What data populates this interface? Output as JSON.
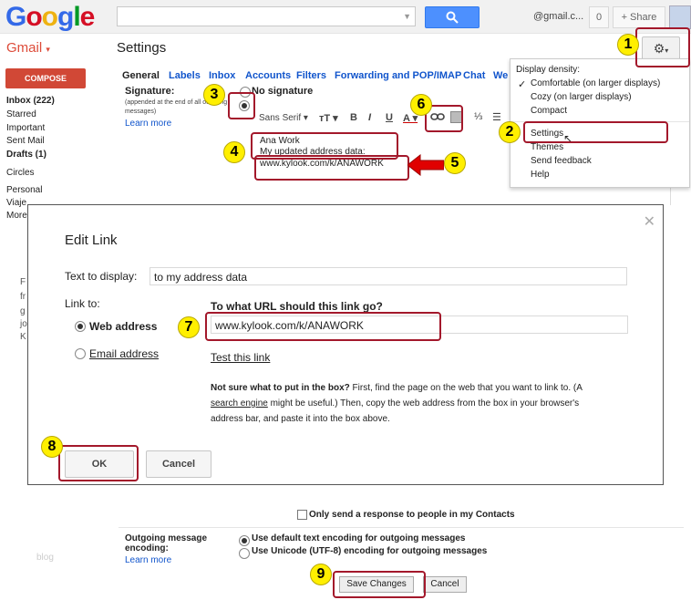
{
  "header": {
    "account": "@gmail.c...",
    "notifications": "0",
    "share": "+ Share",
    "app": "Gmail",
    "page_title": "Settings"
  },
  "sidebar": {
    "compose": "COMPOSE",
    "items": [
      {
        "label": "Inbox (222)",
        "bold": true
      },
      {
        "label": "Starred"
      },
      {
        "label": "Important"
      },
      {
        "label": "Sent Mail"
      },
      {
        "label": "Drafts (1)",
        "bold": true
      },
      {
        "label": "Circles"
      },
      {
        "label": "Personal"
      },
      {
        "label": "Viaje"
      },
      {
        "label": "More"
      }
    ],
    "faint": [
      "F",
      "fr",
      "g",
      "jo",
      "K"
    ],
    "blog": "blog"
  },
  "tabs": [
    "General",
    "Labels",
    "Inbox",
    "Accounts",
    "Filters",
    "Forwarding and POP/IMAP",
    "Chat",
    "We"
  ],
  "signature": {
    "label": "Signature:",
    "note": "(appended at the end of all outgoing messages)",
    "learn_more": "Learn more",
    "no_signature": "No signature",
    "font": "Sans Serif",
    "lines": [
      "Ana Work",
      "My updated address data:",
      "www.kylook.com/k/ANAWORK"
    ]
  },
  "menu": {
    "heading": "Display density:",
    "items": [
      "Comfortable (on larger displays)",
      "Cozy (on larger displays)",
      "Compact",
      "Settings",
      "Themes",
      "Send feedback",
      "Help"
    ]
  },
  "dialog": {
    "title": "Edit Link",
    "text_label": "Text to display:",
    "text_value": "to my address data",
    "link_to": "Link to:",
    "web_address": "Web address",
    "email_address": "Email address",
    "url_question": "To what URL should this link go?",
    "url_value": "www.kylook.com/k/ANAWORK",
    "test_link": "Test this link",
    "help_bold": "Not sure what to put in the box?",
    "help_1": " First, find the page on the web that you want to link to. (A",
    "help_link": "search engine",
    "help_2": " might be useful.) Then, copy the web address from the box in your browser's",
    "help_3": "address bar, and paste it into the box above.",
    "ok": "OK",
    "cancel": "Cancel"
  },
  "bottom": {
    "only_contacts": "Only send a response to people in my Contacts",
    "encoding_label": "Outgoing message encoding:",
    "learn_more": "Learn more",
    "opt_default": "Use default text encoding for outgoing messages",
    "opt_unicode": "Use Unicode (UTF-8) encoding for outgoing messages",
    "save": "Save Changes",
    "cancel": "Cancel"
  },
  "callouts": [
    "1",
    "2",
    "3",
    "4",
    "5",
    "6",
    "7",
    "8",
    "9"
  ]
}
